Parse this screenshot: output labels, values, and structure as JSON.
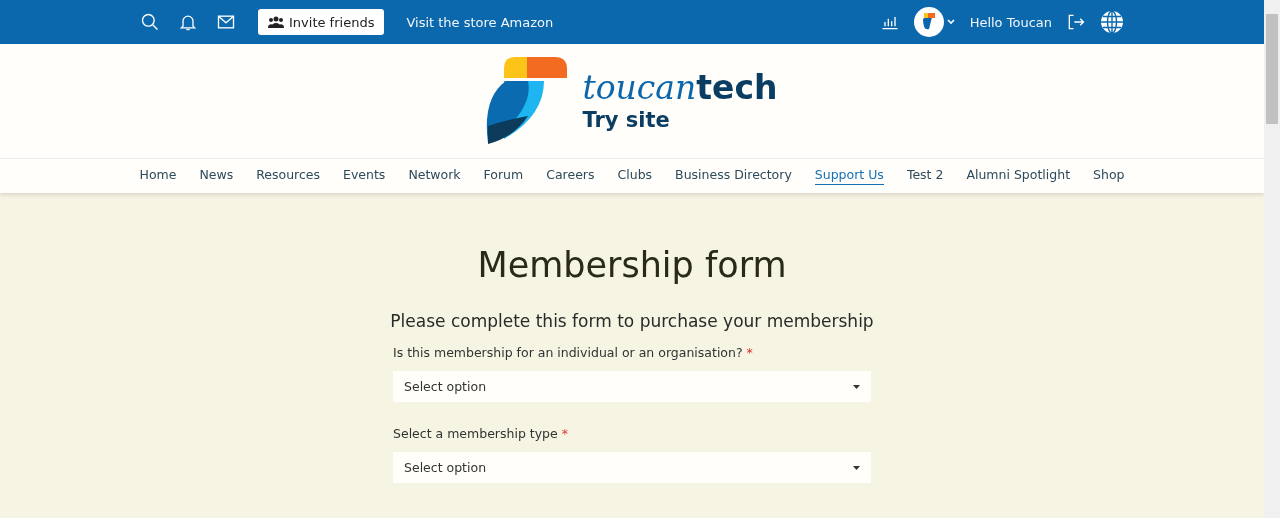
{
  "top_bar": {
    "invite_button": "Invite friends",
    "store_link": "Visit the store Amazon",
    "greeting": "Hello Toucan"
  },
  "brand": {
    "name_script": "toucan",
    "name_bold": "tech",
    "subtitle": "Try site"
  },
  "nav": [
    {
      "label": "Home",
      "selected": false
    },
    {
      "label": "News",
      "selected": false
    },
    {
      "label": "Resources",
      "selected": false
    },
    {
      "label": "Events",
      "selected": false
    },
    {
      "label": "Network",
      "selected": false
    },
    {
      "label": "Forum",
      "selected": false
    },
    {
      "label": "Careers",
      "selected": false
    },
    {
      "label": "Clubs",
      "selected": false
    },
    {
      "label": "Business Directory",
      "selected": false
    },
    {
      "label": "Support Us",
      "selected": true
    },
    {
      "label": "Test 2",
      "selected": false
    },
    {
      "label": "Alumni Spotlight",
      "selected": false
    },
    {
      "label": "Shop",
      "selected": false
    }
  ],
  "form": {
    "title": "Membership form",
    "intro": "Please complete this form to purchase your membership",
    "fields": [
      {
        "label": "Is this membership for an individual or an organisation?",
        "required_mark": "*",
        "placeholder": "Select option"
      },
      {
        "label": "Select a membership type",
        "required_mark": "*",
        "placeholder": "Select option"
      }
    ]
  }
}
